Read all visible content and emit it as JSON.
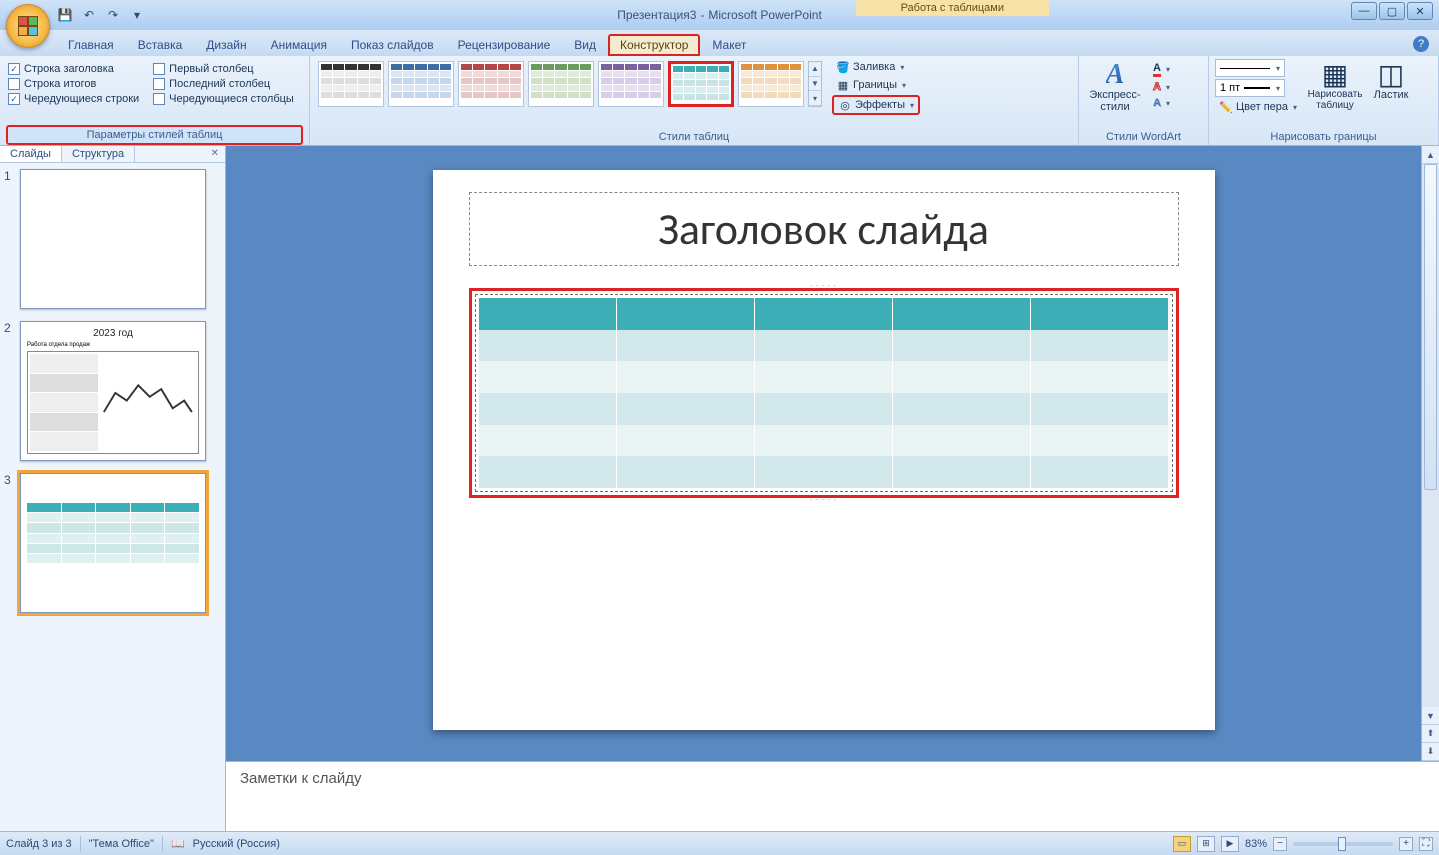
{
  "title": {
    "document": "Презентация3",
    "app": "Microsoft PowerPoint",
    "contextual": "Работа с таблицами"
  },
  "tabs": {
    "home": "Главная",
    "insert": "Вставка",
    "design": "Дизайн",
    "animation": "Анимация",
    "slideshow": "Показ слайдов",
    "review": "Рецензирование",
    "view": "Вид",
    "constructor": "Конструктор",
    "layout": "Макет"
  },
  "ribbon": {
    "options_group": {
      "label": "Параметры стилей таблиц",
      "header_row": "Строка заголовка",
      "total_row": "Строка итогов",
      "banded_rows": "Чередующиеся строки",
      "first_col": "Первый столбец",
      "last_col": "Последний столбец",
      "banded_cols": "Чередующиеся столбцы"
    },
    "styles_group": {
      "label": "Стили таблиц",
      "fill": "Заливка",
      "borders": "Границы",
      "effects": "Эффекты"
    },
    "wordart_group": {
      "label": "Стили WordArt",
      "express": "Экспресс-стили"
    },
    "draw_group": {
      "label": "Нарисовать границы",
      "pen_weight": "1 пт",
      "pen_color": "Цвет пера",
      "draw_table": "Нарисовать таблицу",
      "eraser": "Ластик"
    }
  },
  "slide_panel": {
    "tabs": {
      "slides": "Слайды",
      "outline": "Структура"
    }
  },
  "slides": {
    "s1": {
      "num": "1"
    },
    "s2": {
      "num": "2",
      "title": "2023 год",
      "subtitle": "Работа отдела продаж"
    },
    "s3": {
      "num": "3"
    }
  },
  "editor": {
    "title_placeholder": "Заголовок слайда",
    "notes_placeholder": "Заметки к слайду"
  },
  "status": {
    "slide_pos": "Слайд 3 из 3",
    "theme": "\"Тема Office\"",
    "lang": "Русский (Россия)",
    "zoom": "83%"
  }
}
